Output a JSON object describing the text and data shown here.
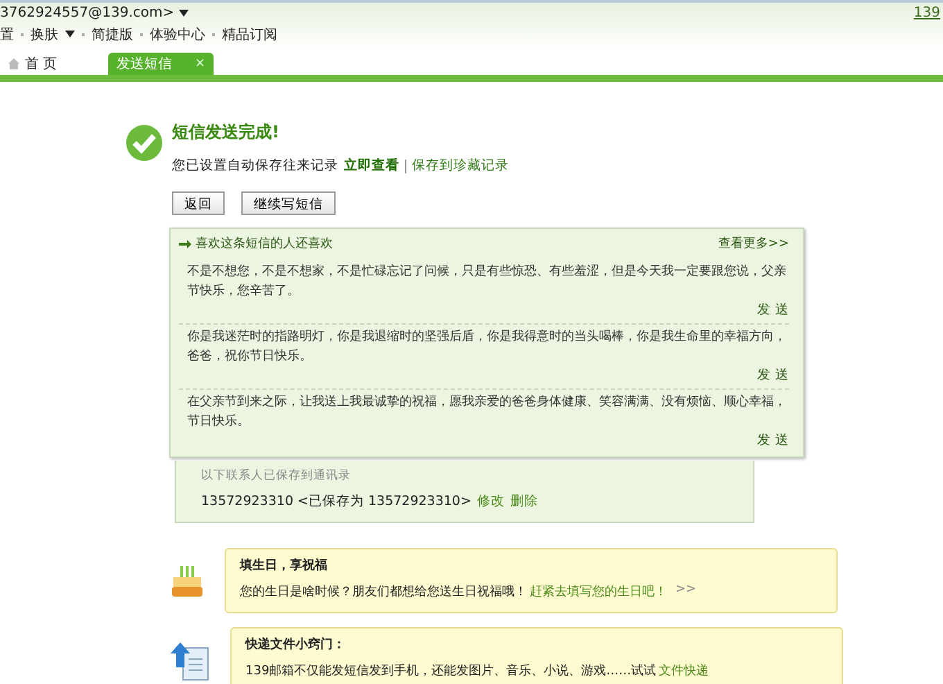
{
  "header": {
    "account": "3762924557@139.com>",
    "right_link": "139",
    "nav": [
      {
        "label": "置",
        "caret": false
      },
      {
        "label": "换肤",
        "caret": true
      },
      {
        "label": "简捷版",
        "caret": false
      },
      {
        "label": "体验中心",
        "caret": false
      },
      {
        "label": "精品订阅",
        "caret": false
      }
    ]
  },
  "tabs": [
    {
      "label": "首 页",
      "selected": false
    },
    {
      "label": "发送短信",
      "selected": true,
      "close": "×"
    }
  ],
  "result": {
    "title": "短信发送完成!",
    "note": "您已设置自动保存往来记录",
    "view_link": "立即查看",
    "save_link": "保存到珍藏记录",
    "buttons": [
      "返回",
      "继续写短信"
    ]
  },
  "suggestions": {
    "title": "喜欢这条短信的人还喜欢",
    "more": "查看更多>>",
    "items": [
      {
        "text": "不是不想您，不是不想家，不是忙碌忘记了问候，只是有些惊恐、有些羞涩，但是今天我一定要跟您说，父亲节快乐，您辛苦了。",
        "send": "发 送"
      },
      {
        "text": "你是我迷茫时的指路明灯，你是我退缩时的坚强后盾，你是我得意时的当头喝棒，你是我生命里的幸福方向，爸爸，祝你节日快乐。",
        "send": "发 送"
      },
      {
        "text": "在父亲节到来之际，让我送上我最诚挚的祝福，愿我亲爱的爸爸身体健康、笑容满满、没有烦恼、顺心幸福，节日快乐。",
        "send": "发 送"
      }
    ]
  },
  "contacts": {
    "title": "以下联系人已保存到通讯录",
    "entry": "13572923310 <已保存为  13572923310>",
    "edit": "修改",
    "delete": "删除"
  },
  "tips": [
    {
      "kind": "birthday",
      "title": "填生日，享祝福",
      "text": "您的生日是啥时候？朋友们都想给您送生日祝福哦！",
      "link": "赶紧去填写您的生日吧！",
      "more": ">>"
    },
    {
      "kind": "upload",
      "title": "快递文件小窍门：",
      "text": "139邮箱不仅能发短信发到手机，还能发图片、音乐、小说、游戏……试试",
      "link": "文件快递"
    }
  ]
}
